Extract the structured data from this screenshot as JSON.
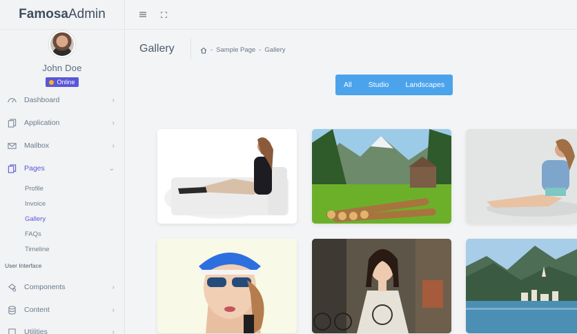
{
  "brand": {
    "bold": "Famosa",
    "light": "Admin"
  },
  "user": {
    "name": "John Doe",
    "status": "Online"
  },
  "menu": {
    "dashboard": "Dashboard",
    "application": "Application",
    "mailbox": "Mailbox",
    "pages": "Pages",
    "sub": [
      "Profile",
      "Invoice",
      "Gallery",
      "FAQs",
      "Timeline"
    ],
    "section": "User Interface",
    "components": "Components",
    "content": "Content",
    "utilities": "Utilities"
  },
  "page": {
    "title": "Gallery",
    "breadcrumb": [
      "Sample Page",
      "Gallery"
    ],
    "separator": "-"
  },
  "filters": [
    "All",
    "Studio",
    "Landscapes"
  ],
  "colors": {
    "accent": "#5b57d6",
    "filter_bg": "#4ba3ec"
  },
  "icons": {
    "menu": "hamburger-icon",
    "fullscreen": "expand-icon",
    "home": "home-icon"
  }
}
